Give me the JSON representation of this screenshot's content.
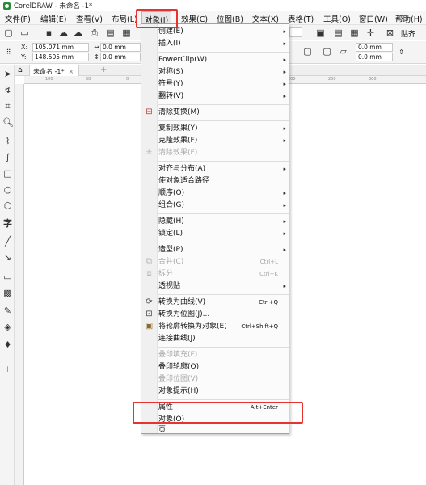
{
  "titlebar": {
    "title": "CorelDRAW - 未命名 -1*"
  },
  "menubar": {
    "items": [
      "文件(F)",
      "编辑(E)",
      "查看(V)",
      "布局(L)",
      "对象(J)",
      "效果(C)",
      "位图(B)",
      "文本(X)",
      "表格(T)",
      "工具(O)",
      "窗口(W)",
      "帮助(H)"
    ]
  },
  "toolbar": {
    "paste_label": "贴齐"
  },
  "propbar": {
    "x_label": "X:",
    "x_value": "105.071 mm",
    "y_label": "Y:",
    "y_value": "148.505 mm",
    "w_value": "0.0 mm",
    "h_value": "0.0 mm",
    "r1_value": "0.0 mm",
    "r2_value": "0.0 mm"
  },
  "document_tab": {
    "label": "未命名 -1*"
  },
  "ruler": {
    "h_ticks": [
      "100",
      "50",
      "0",
      "50",
      "100",
      "150",
      "200",
      "250",
      "300"
    ]
  },
  "object_menu": {
    "items": [
      {
        "label": "创建(E)",
        "arrow": "▸"
      },
      {
        "label": "插入(I)",
        "arrow": "▸"
      },
      {
        "label": "PowerClip(W)",
        "arrow": "▸"
      },
      {
        "label": "对称(S)",
        "arrow": "▸"
      },
      {
        "label": "符号(Y)",
        "arrow": "▸"
      },
      {
        "label": "翻转(V)",
        "arrow": "▸"
      },
      {
        "label": "清除变换(M)"
      },
      {
        "label": "复制效果(Y)",
        "arrow": "▸"
      },
      {
        "label": "克隆效果(F)",
        "arrow": "▸"
      },
      {
        "label": "清除效果(F)",
        "disabled": true
      },
      {
        "label": "对齐与分布(A)",
        "arrow": "▸"
      },
      {
        "label": "使对象适合路径"
      },
      {
        "label": "顺序(O)",
        "arrow": "▸"
      },
      {
        "label": "组合(G)",
        "arrow": "▸"
      },
      {
        "label": "隐藏(H)",
        "arrow": "▸"
      },
      {
        "label": "锁定(L)",
        "arrow": "▸"
      },
      {
        "label": "造型(P)",
        "arrow": "▸"
      },
      {
        "label": "合并(C)",
        "shortcut": "Ctrl+L",
        "disabled": true
      },
      {
        "label": "拆分",
        "shortcut": "Ctrl+K",
        "disabled": true
      },
      {
        "label": "透视贴",
        "arrow": "▸"
      },
      {
        "label": "转换为曲线(V)",
        "shortcut": "Ctrl+Q"
      },
      {
        "label": "转换为位图(J)..."
      },
      {
        "label": "将轮廓转换为对象(E)",
        "shortcut": "Ctrl+Shift+Q"
      },
      {
        "label": "连接曲线(J)"
      },
      {
        "label": "叠印填充(F)",
        "disabled": true
      },
      {
        "label": "叠印轮廓(O)"
      },
      {
        "label": "叠印位图(V)",
        "disabled": true
      },
      {
        "label": "对象提示(H)"
      },
      {
        "label": "属性",
        "shortcut": "Alt+Enter"
      },
      {
        "label": "对象(O)"
      },
      {
        "label": "页"
      }
    ]
  },
  "colors": {
    "highlight": "#e8322f",
    "logo": "#2a8a3e"
  }
}
